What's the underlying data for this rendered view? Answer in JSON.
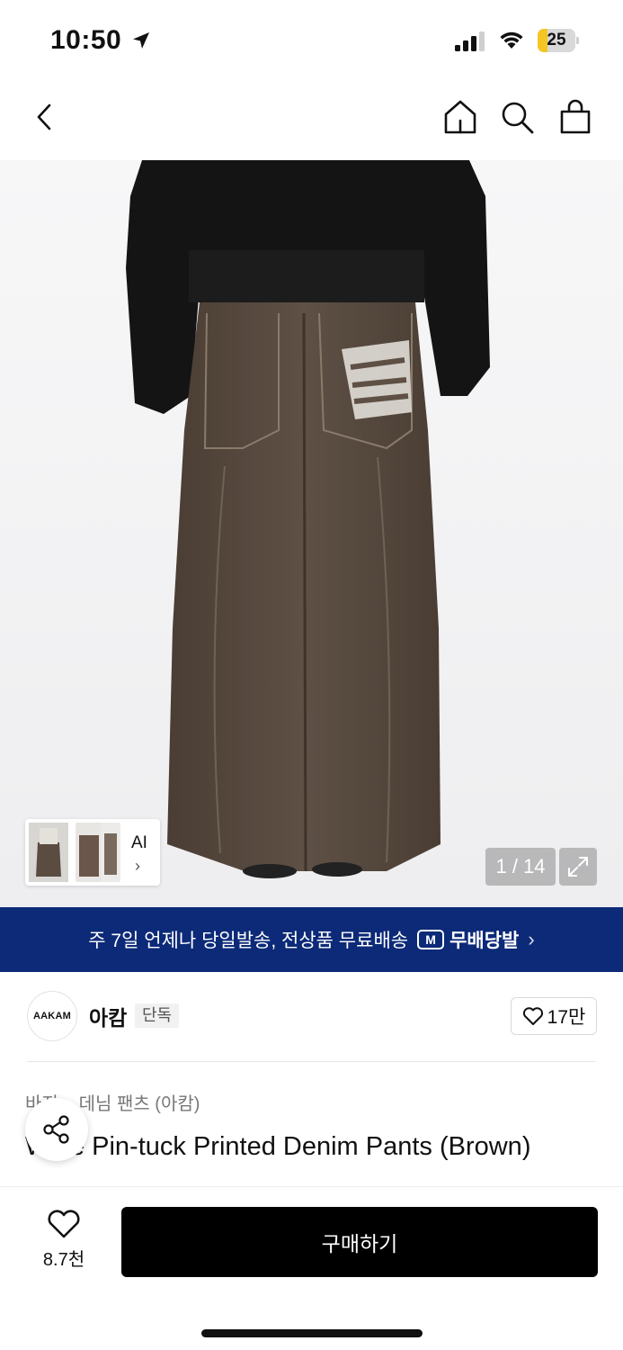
{
  "status_bar": {
    "time": "10:50",
    "battery_level": "25",
    "battery_fraction": 0.25,
    "battery_color": "#f4c623",
    "icons": [
      "location-arrow-icon",
      "signal-icon",
      "wifi-icon",
      "battery-icon"
    ]
  },
  "nav": {
    "icons": [
      "back-chevron-icon",
      "home-icon",
      "search-icon",
      "shopping-bag-icon"
    ]
  },
  "gallery": {
    "ai_label": "AI",
    "ai_chevron": "›",
    "counter": "1 / 14",
    "expand_icon": "expand-icon"
  },
  "banner": {
    "text": "주 7일 언제나 당일발송, 전상품 무료배송",
    "brand_badge": "M",
    "brand_text": "무배당발",
    "chevron": "›",
    "background": "#0c2a78"
  },
  "brand": {
    "logo_text": "AAKAM",
    "name": "아캄",
    "tag": "단독",
    "likes": "17만"
  },
  "product": {
    "breadcrumb": "바지 > 데님 팬츠 (아캄)",
    "title": "Wide Pin-tuck Printed Denim Pants (Brown)"
  },
  "bottom_bar": {
    "wishlist_count": "8.7천",
    "buy_label": "구매하기"
  }
}
